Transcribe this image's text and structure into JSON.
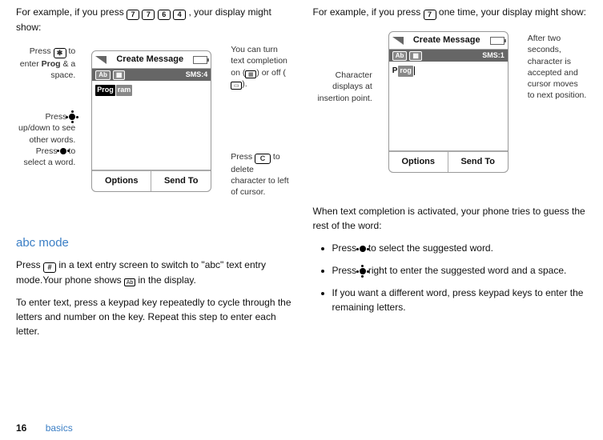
{
  "left": {
    "intro_a": "For example, if you press ",
    "keys": [
      "7",
      "7",
      "6",
      "4"
    ],
    "intro_b": ", your display might show:",
    "callouts": {
      "c1_a": "Press ",
      "c1_b": " to enter ",
      "c1_bold": "Prog",
      "c1_c": " & a space.",
      "c2_a": "Press ",
      "c2_b": " up/down to see other words. Press ",
      "c2_c": " to select a word.",
      "c3": "You can turn text completion on (",
      "c3_mid": ") or off (",
      "c3_end": ").",
      "c4_a": "Press ",
      "c4_b": " to delete character to left of cursor."
    },
    "phone": {
      "title": "Create Message",
      "status_right": "SMS:4",
      "typed_dark": "Prog",
      "typed_light": "ram",
      "sk_left": "Options",
      "sk_right": "Send To"
    },
    "mode_heading": "abc mode",
    "para2_a": "Press ",
    "para2_key": "#",
    "para2_b": " in a text entry screen to switch to \"abc\" text entry mode.Your phone shows ",
    "para2_c": " in the display.",
    "para3": "To enter text, press a keypad key repeatedly to cycle through the letters and number on the key. Repeat this step to enter each letter."
  },
  "right": {
    "intro_a": "For example, if you press ",
    "key": "7",
    "intro_b": " one time, your display might show:",
    "callouts": {
      "c1": "Character displays at insertion point.",
      "c2": "After two seconds, character is accepted and cursor moves to next position."
    },
    "phone": {
      "title": "Create Message",
      "status_right": "SMS:1",
      "typed_char": "P",
      "typed_light": "rog",
      "sk_left": "Options",
      "sk_right": "Send To"
    },
    "para2": "When text completion is activated, your phone tries to guess the rest of the word:",
    "bullets": {
      "b1_a": "Press ",
      "b1_b": " to select the suggested word.",
      "b2_a": "Press ",
      "b2_b": " right to enter the suggested word and a space.",
      "b3": "If you want a different word, press keypad keys to enter the remaining letters."
    }
  },
  "footer": {
    "page": "16",
    "section": "basics"
  }
}
